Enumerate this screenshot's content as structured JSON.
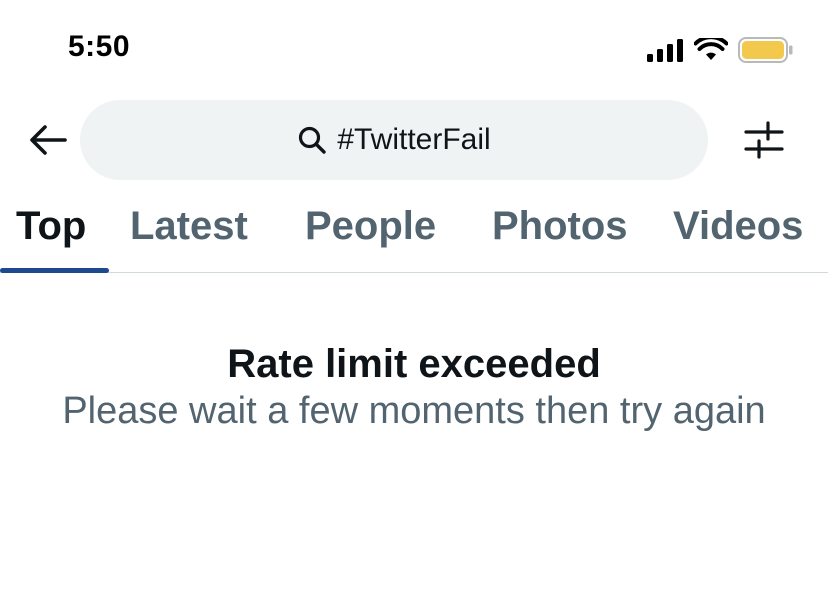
{
  "status_bar": {
    "time": "5:50",
    "icons": [
      "signal-icon",
      "wifi-icon",
      "battery-icon"
    ],
    "battery_color": "#f2c94c"
  },
  "header": {
    "back_icon": "back-arrow-icon",
    "search_query": "#TwitterFail",
    "search_icon": "search-icon",
    "filter_icon": "filter-sliders-icon"
  },
  "tabs": [
    {
      "label": "Top",
      "active": true
    },
    {
      "label": "Latest",
      "active": false
    },
    {
      "label": "People",
      "active": false
    },
    {
      "label": "Photos",
      "active": false
    },
    {
      "label": "Videos",
      "active": false
    }
  ],
  "message": {
    "title": "Rate limit exceeded",
    "subtitle": "Please wait a few moments then try again"
  },
  "colors": {
    "accent": "#1d4a8f",
    "text_primary": "#0f1419",
    "text_secondary": "#536471",
    "search_bg": "#eff3f4"
  }
}
